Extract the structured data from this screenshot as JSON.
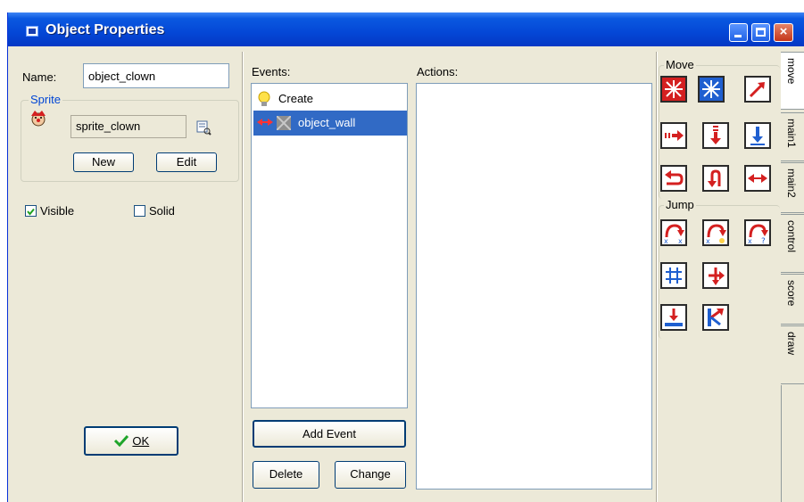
{
  "window": {
    "title": "Object Properties"
  },
  "left": {
    "name_label": "Name:",
    "name_value": "object_clown",
    "sprite_group": "Sprite",
    "sprite_value": "sprite_clown",
    "new_label": "New",
    "edit_label": "Edit",
    "visible_label": "Visible",
    "visible_checked": true,
    "solid_label": "Solid",
    "solid_checked": false,
    "ok_label": "OK"
  },
  "events": {
    "header": "Events:",
    "items": [
      {
        "label": "Create",
        "icon": "lightbulb-icon",
        "selected": false
      },
      {
        "label": "object_wall",
        "icon": "collision-icon",
        "selected": true
      }
    ],
    "add_label": "Add Event",
    "delete_label": "Delete",
    "change_label": "Change"
  },
  "actions": {
    "header": "Actions:"
  },
  "palette": {
    "move_group": "Move",
    "jump_group": "Jump",
    "tabs": [
      "move",
      "main1",
      "main2",
      "control",
      "score",
      "draw"
    ],
    "active_tab": "move",
    "colors": {
      "action_red": "#d42020",
      "action_blue": "#1f5fd0"
    }
  }
}
